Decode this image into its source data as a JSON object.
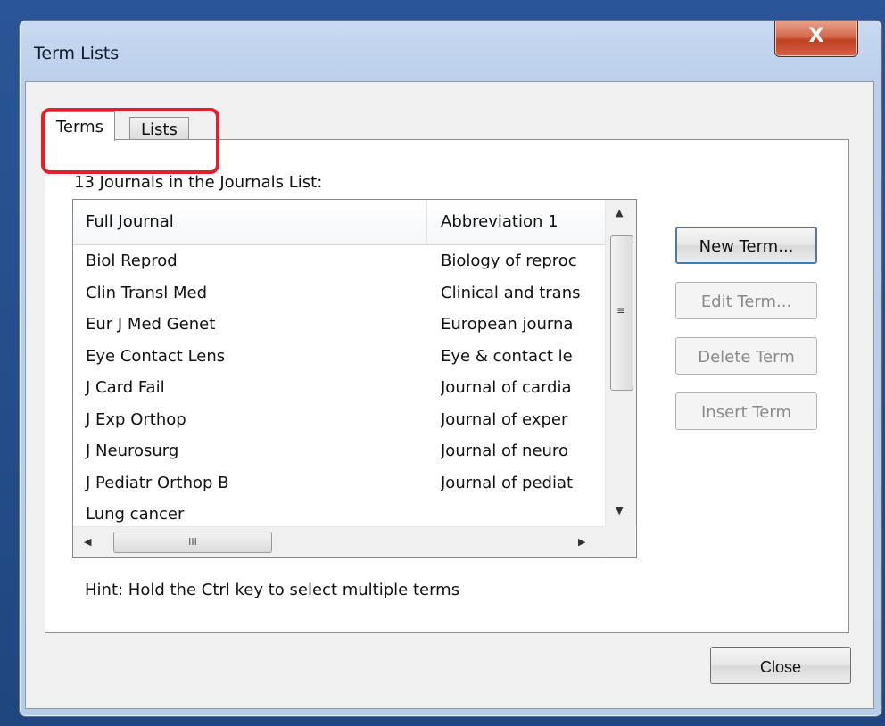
{
  "dialog": {
    "title": "Term Lists",
    "close_glyph": "X"
  },
  "tabs": [
    {
      "label": "Terms",
      "active": true
    },
    {
      "label": "Lists",
      "active": false
    }
  ],
  "count_label": "13 Journals in the Journals List:",
  "table": {
    "columns": [
      "Full Journal",
      "Abbreviation 1"
    ],
    "rows": [
      {
        "full": "Biol Reprod",
        "abbr": "Biology of reproc"
      },
      {
        "full": "Clin Transl Med",
        "abbr": "Clinical and trans"
      },
      {
        "full": "Eur J Med Genet",
        "abbr": "European journa"
      },
      {
        "full": "Eye Contact Lens",
        "abbr": "Eye & contact le"
      },
      {
        "full": "J Card Fail",
        "abbr": "Journal of cardia"
      },
      {
        "full": "J Exp Orthop",
        "abbr": "Journal of exper"
      },
      {
        "full": "J Neurosurg",
        "abbr": "Journal of neuro"
      },
      {
        "full": "J Pediatr Orthop B",
        "abbr": "Journal of pediat"
      },
      {
        "full": "Lung cancer",
        "abbr": ""
      }
    ],
    "hscroll_thumb_glyph": "III"
  },
  "buttons": {
    "new_term": "New Term...",
    "edit_term": "Edit Term...",
    "delete_term": "Delete Term",
    "insert_term": "Insert Term",
    "close": "Close"
  },
  "hint": "Hint: Hold the Ctrl key to select multiple terms",
  "colors": {
    "highlight_ring": "#e0202a",
    "close_button": "#c1401f",
    "desktop": "#1c3f78"
  }
}
